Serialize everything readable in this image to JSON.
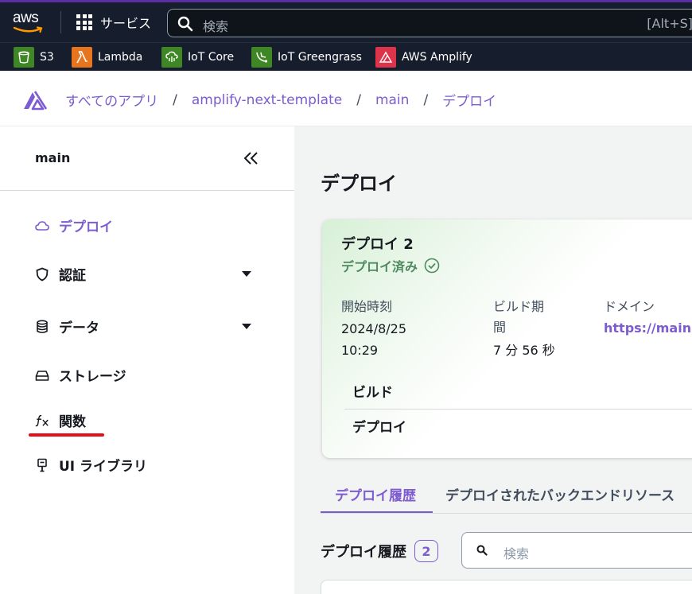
{
  "topnav": {
    "logo_text": "aws",
    "services_label": "サービス",
    "search_placeholder": "検索",
    "search_shortcut": "[Alt+S]"
  },
  "favorites": [
    {
      "label": "S3",
      "icon": "s3-icon",
      "color": "#3f8624"
    },
    {
      "label": "Lambda",
      "icon": "lambda-icon",
      "color": "#e7751d"
    },
    {
      "label": "IoT Core",
      "icon": "iot-core-icon",
      "color": "#3f8624"
    },
    {
      "label": "IoT Greengrass",
      "icon": "iot-greengrass-icon",
      "color": "#3f8624"
    },
    {
      "label": "AWS Amplify",
      "icon": "amplify-icon",
      "color": "#dd344c"
    }
  ],
  "breadcrumb": [
    "すべてのアプリ",
    "amplify-next-template",
    "main",
    "デプロイ"
  ],
  "sidebar": {
    "title": "main",
    "items": [
      {
        "label": "デプロイ",
        "icon": "cloud-icon",
        "active": true
      },
      {
        "label": "認証",
        "icon": "shield-icon",
        "expandable": true
      },
      {
        "label": "データ",
        "icon": "database-icon",
        "expandable": true
      },
      {
        "label": "ストレージ",
        "icon": "storage-icon"
      },
      {
        "label": "関数",
        "icon": "function-icon"
      },
      {
        "label": "UI ライブラリ",
        "icon": "ui-library-icon"
      }
    ]
  },
  "main": {
    "title": "デプロイ",
    "card": {
      "title": "デプロイ 2",
      "status": "デプロイ済み",
      "start_label": "開始時刻",
      "start_date": "2024/8/25",
      "start_time": "10:29",
      "build_duration_label_1": "ビルド期",
      "build_duration_label_2": "間",
      "build_duration_value": "7 分 56 秒",
      "domain_label": "ドメイン",
      "domain_value": "https://main.",
      "step_build": "ビルド",
      "step_deploy": "デプロイ"
    },
    "tabs": [
      "デプロイ履歴",
      "デプロイされたバックエンドリソース"
    ],
    "history": {
      "title": "デプロイ履歴",
      "count": "2",
      "search_placeholder": "検索"
    }
  },
  "colors": {
    "accent": "#7d5bd1",
    "success": "#4d8a5f",
    "highlight": "#e3101a",
    "nav_bg": "#161e2d"
  }
}
